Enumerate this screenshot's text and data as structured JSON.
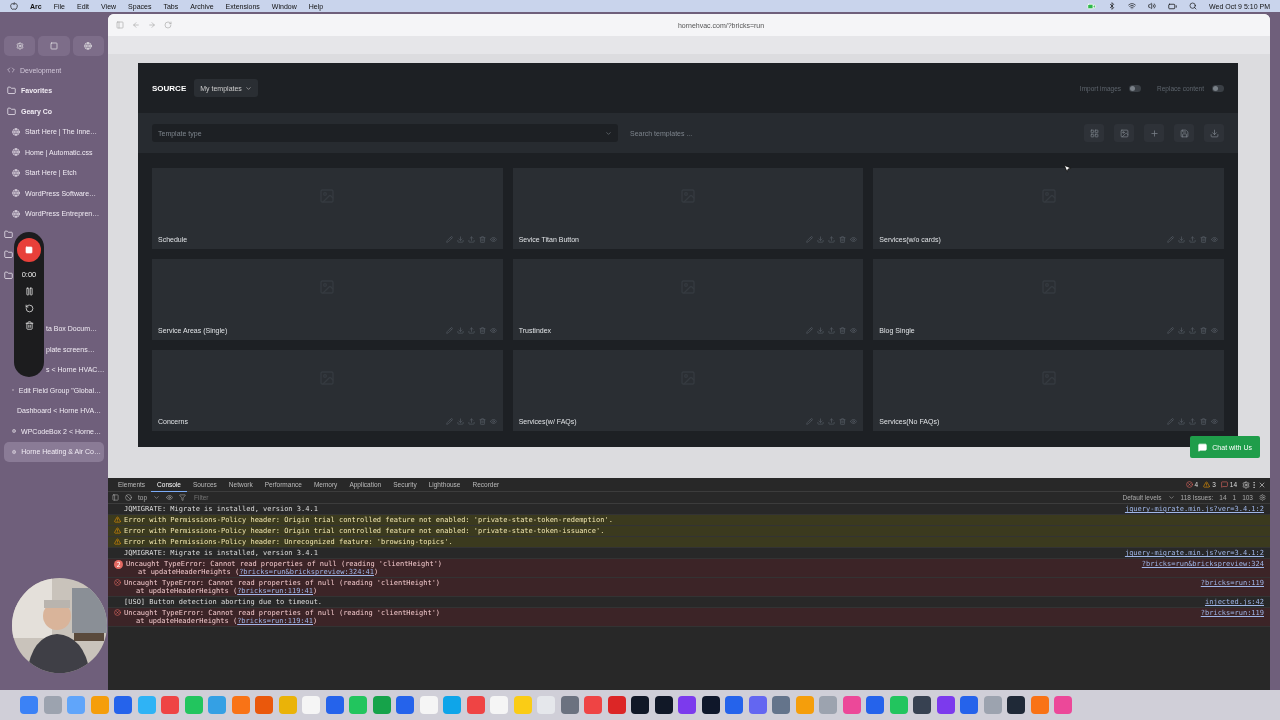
{
  "menubar": {
    "app": "Arc",
    "menus": [
      "File",
      "Edit",
      "View",
      "Spaces",
      "Tabs",
      "Archive",
      "Extensions",
      "Window",
      "Help"
    ],
    "clock": "Wed Oct 9  5:10 PM"
  },
  "sidebar": {
    "section": "Development",
    "items": [
      {
        "kind": "folder",
        "label": "Favorites",
        "selected": false
      },
      {
        "kind": "folder",
        "label": "Geary Co",
        "selected": false
      },
      {
        "kind": "tab",
        "label": "Start Here | The Inne…",
        "selected": false
      },
      {
        "kind": "tab",
        "label": "Home | Automatic.css",
        "selected": false
      },
      {
        "kind": "tab",
        "label": "Start Here | Etch",
        "selected": false
      },
      {
        "kind": "tab",
        "label": "WordPress Software…",
        "selected": false
      },
      {
        "kind": "tab",
        "label": "WordPress Entrepren…",
        "selected": false
      },
      {
        "kind": "hidden-folder",
        "selected": false
      },
      {
        "kind": "hidden-folder",
        "selected": false
      },
      {
        "kind": "hidden-folder",
        "selected": false
      },
      {
        "kind": "clipped",
        "label": "ta Box Docum…",
        "selected": false
      },
      {
        "kind": "clipped",
        "label": "plate screens…",
        "selected": false
      },
      {
        "kind": "clipped",
        "label": "s < Horne HVAC…",
        "selected": false
      },
      {
        "kind": "tab",
        "label": "Edit Field Group \"Global…",
        "selected": false
      },
      {
        "kind": "tab",
        "label": "Dashboard < Horne HVA…",
        "selected": false
      },
      {
        "kind": "tab",
        "label": "WPCodeBox 2 < Horne…",
        "selected": false
      },
      {
        "kind": "tab",
        "label": "Horne Heating & Air Co…",
        "selected": true
      }
    ]
  },
  "recorder": {
    "time": "0:00"
  },
  "browser": {
    "url": "hornehvac.com/?bricks=run"
  },
  "modal": {
    "source_label": "SOURCE",
    "source_value": "My templates",
    "toggles": [
      {
        "label": "Import images",
        "on": false
      },
      {
        "label": "Replace content",
        "on": false
      }
    ],
    "type_placeholder": "Template type",
    "search_placeholder": "Search templates ...",
    "templates": [
      {
        "name": "Schedule"
      },
      {
        "name": "Sevice Titan Button"
      },
      {
        "name": "Services(w/o cards)"
      },
      {
        "name": "Service Areas (Single)"
      },
      {
        "name": "Trustindex"
      },
      {
        "name": "Blog Single"
      },
      {
        "name": "Concerns"
      },
      {
        "name": "Services(w/ FAQs)"
      },
      {
        "name": "Services(No FAQs)"
      }
    ]
  },
  "chat_button": "Chat with Us",
  "devtools": {
    "tabs": [
      {
        "label": "Elements",
        "selected": false
      },
      {
        "label": "Console",
        "selected": true
      },
      {
        "label": "Sources",
        "selected": false
      },
      {
        "label": "Network",
        "selected": false
      },
      {
        "label": "Performance",
        "selected": false
      },
      {
        "label": "Memory",
        "selected": false
      },
      {
        "label": "Application",
        "selected": false
      },
      {
        "label": "Security",
        "selected": false
      },
      {
        "label": "Lighthouse",
        "selected": false
      },
      {
        "label": "Recorder",
        "selected": false
      }
    ],
    "errors": "4",
    "warnings": "3",
    "messages": "14",
    "context": "top",
    "filter_placeholder": "Filter",
    "levels": "Default levels",
    "issues_label": "118 Issues:",
    "issue_counts": [
      "14",
      "1",
      "103"
    ],
    "lines": [
      {
        "kind": "log",
        "text": "JQMIGRATE: Migrate is installed, version 3.4.1",
        "source": "jquery-migrate.min.js?ver=3.4.1:2"
      },
      {
        "kind": "warning",
        "text": "Error with Permissions-Policy header: Origin trial controlled feature not enabled: 'private-state-token-redemption'."
      },
      {
        "kind": "warning",
        "text": "Error with Permissions-Policy header: Origin trial controlled feature not enabled: 'private-state-token-issuance'."
      },
      {
        "kind": "warning",
        "text": "Error with Permissions-Policy header: Unrecognized feature: 'browsing-topics'."
      },
      {
        "kind": "log",
        "text": "JQMIGRATE: Migrate is installed, version 3.4.1",
        "source": "jquery-migrate.min.js?ver=3.4.1:2"
      },
      {
        "kind": "error",
        "count": "2",
        "text": "Uncaught TypeError: Cannot read properties of null (reading 'clientHeight')",
        "trace": "at updateHeaderHeights (",
        "trace_link": "?bricks=run&brickspreview:324:41",
        "trace_end": ")",
        "source": "?bricks=run&brickspreview:324"
      },
      {
        "kind": "error",
        "text": "Uncaught TypeError: Cannot read properties of null (reading 'clientHeight')",
        "trace": "at updateHeaderHeights (",
        "trace_link": "?bricks=run:119:41",
        "trace_end": ")",
        "source": "?bricks=run:119"
      },
      {
        "kind": "log",
        "text": "[USO] Button detection aborting due to timeout.",
        "source": "injected.js:42"
      },
      {
        "kind": "error",
        "text": "Uncaught TypeError: Cannot read properties of null (reading 'clientHeight')",
        "trace": "at updateHeaderHeights (",
        "trace_link": "?bricks=run:119:41",
        "trace_end": ")",
        "source": "?bricks=run:119"
      }
    ]
  }
}
